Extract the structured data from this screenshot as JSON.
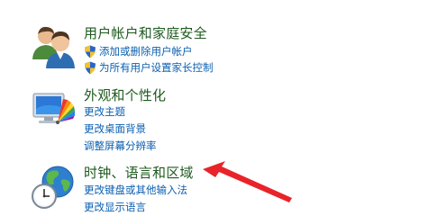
{
  "categories": [
    {
      "title": "用户帐户和家庭安全",
      "icon": "users-icon",
      "tasks": [
        {
          "label": "添加或删除用户帐户",
          "icon": "uac-shield-icon"
        },
        {
          "label": "为所有用户设置家长控制",
          "icon": "uac-shield-icon"
        }
      ]
    },
    {
      "title": "外观和个性化",
      "icon": "monitor-palette-icon",
      "tasks": [
        {
          "label": "更改主题"
        },
        {
          "label": "更改桌面背景"
        },
        {
          "label": "调整屏幕分辨率"
        }
      ]
    },
    {
      "title": "时钟、语言和区域",
      "icon": "clock-globe-icon",
      "tasks": [
        {
          "label": "更改键盘或其他输入法"
        },
        {
          "label": "更改显示语言"
        }
      ]
    }
  ],
  "annotation": {
    "icon": "red-arrow-icon",
    "color": "#e8232a"
  },
  "colors": {
    "category_title": "#1e5a1e",
    "task_link": "#0b5fb1"
  }
}
